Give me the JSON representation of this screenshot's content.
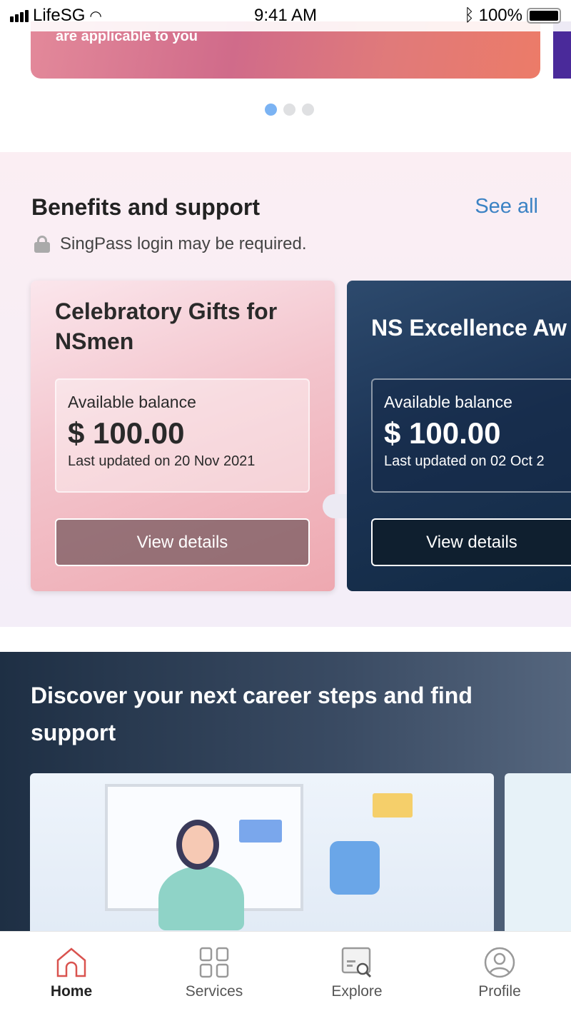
{
  "status_bar": {
    "carrier": "LifeSG",
    "time": "9:41 AM",
    "battery": "100%"
  },
  "banner": {
    "text": "are applicable to you"
  },
  "carousel": {
    "pages": 3,
    "active": 1
  },
  "benefits": {
    "title": "Benefits and support",
    "see_all": "See all",
    "note": "SingPass login may be required.",
    "cards": [
      {
        "title": "Celebratory Gifts for NSmen",
        "balance_label": "Available balance",
        "amount": "$ 100.00",
        "updated": "Last updated on 20 Nov 2021",
        "button": "View details"
      },
      {
        "title": "NS Excellence Aw",
        "balance_label": "Available balance",
        "amount": "$ 100.00",
        "updated": "Last updated on 02 Oct 2",
        "button": "View details"
      }
    ]
  },
  "career": {
    "title": "Discover your next career steps and find support"
  },
  "nav": {
    "items": [
      {
        "label": "Home",
        "icon": "home-icon",
        "active": true
      },
      {
        "label": "Services",
        "icon": "grid-icon"
      },
      {
        "label": "Explore",
        "icon": "explore-icon"
      },
      {
        "label": "Profile",
        "icon": "profile-icon"
      }
    ]
  },
  "colors": {
    "accent": "#3b82c4",
    "home_active": "#d9534f"
  }
}
